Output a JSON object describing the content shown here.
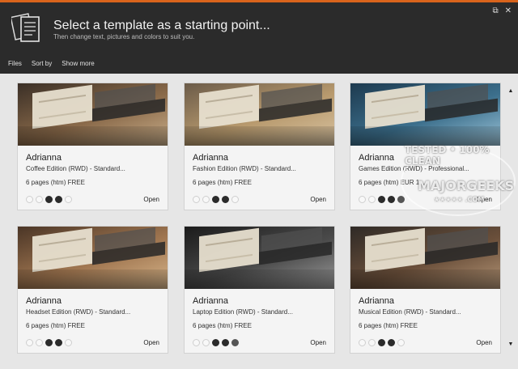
{
  "header": {
    "title": "Select a template as a starting point...",
    "subtitle": "Then change text, pictures and colors to suit you.",
    "restore_icon": "restore-icon",
    "close_label": "✕",
    "restore_label": "⧉"
  },
  "toolbar": {
    "files": "Files",
    "sort_by": "Sort by",
    "show_more": "Show more"
  },
  "templates": [
    {
      "name": "Adrianna",
      "edition": "Coffee Edition (RWD) - Standard...",
      "pages": "6 pages (htm) FREE",
      "open": "Open",
      "palette": [
        "#3a2f26",
        "#8a6a4a",
        "#c9ae8a"
      ]
    },
    {
      "name": "Adrianna",
      "edition": "Fashion Edition (RWD) - Standard...",
      "pages": "6 pages (htm) FREE",
      "open": "Open",
      "palette": [
        "#6b5b49",
        "#b89a6e",
        "#d8c3a1"
      ]
    },
    {
      "name": "Adrianna",
      "edition": "Games Edition (RWD) - Professional...",
      "pages": "6 pages (htm) EUR 1...",
      "open": "Open",
      "palette": [
        "#1d3a4f",
        "#3c6f8c",
        "#9cc4d8"
      ]
    },
    {
      "name": "Adrianna",
      "edition": "Headset Edition (RWD) - Standard...",
      "pages": "6 pages (htm) FREE",
      "open": "Open",
      "palette": [
        "#4a3526",
        "#a07650",
        "#d7b58a"
      ]
    },
    {
      "name": "Adrianna",
      "edition": "Laptop Edition (RWD) - Standard...",
      "pages": "6 pages (htm) FREE",
      "open": "Open",
      "palette": [
        "#1b1b1b",
        "#4a4a4a",
        "#9a9a9a"
      ]
    },
    {
      "name": "Adrianna",
      "edition": "Musical Edition (RWD) - Standard...",
      "pages": "6 pages (htm) FREE",
      "open": "Open",
      "palette": [
        "#2f2a26",
        "#6a4f3a",
        "#b49576"
      ]
    }
  ],
  "dots": [
    [
      false,
      false,
      true,
      true,
      false
    ],
    [
      false,
      false,
      true,
      true,
      false
    ],
    [
      false,
      false,
      true,
      true,
      "gray"
    ],
    [
      false,
      false,
      true,
      true,
      false
    ],
    [
      false,
      false,
      true,
      true,
      "gray"
    ],
    [
      false,
      false,
      true,
      true,
      false
    ]
  ],
  "watermark": {
    "line1": "TESTED • 100% CLEAN",
    "line2": "MAJORGEEKS",
    "line3": "★★★★★ .COM"
  },
  "colors": {
    "accent": "#d9641c",
    "header_bg": "#2b2b2b",
    "content_bg": "#e6e6e6"
  }
}
